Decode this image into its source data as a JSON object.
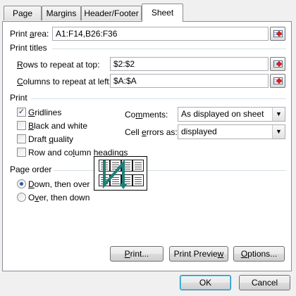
{
  "tabs": [
    "Page",
    "Margins",
    "Header/Footer",
    "Sheet"
  ],
  "active_tab": "Sheet",
  "print_area": {
    "label_pre": "Print ",
    "label_key": "a",
    "label_post": "rea:",
    "value": "A1:F14,B26:F36"
  },
  "print_titles": {
    "heading": "Print titles",
    "rows": {
      "label_key": "R",
      "label_post": "ows to repeat at top:",
      "value": "$2:$2"
    },
    "cols": {
      "label_key": "C",
      "label_post": "olumns to repeat at left:",
      "value": "$A:$A"
    }
  },
  "print": {
    "heading": "Print",
    "gridlines": {
      "label_key": "G",
      "label_post": "ridlines",
      "checked": true
    },
    "black_white": {
      "label_key": "B",
      "label_post": "lack and white",
      "checked": false
    },
    "draft": {
      "label_pre": "Draft ",
      "label_key": "q",
      "label_post": "uality",
      "checked": false
    },
    "row_col_headings": {
      "label_pre": "Row and co",
      "label_key": "l",
      "label_post": "umn headings",
      "checked": false
    },
    "comments": {
      "label_pre": "Co",
      "label_key": "m",
      "label_post": "ments:",
      "value": "As displayed on sheet"
    },
    "cell_errors": {
      "label_pre": "Cell ",
      "label_key": "e",
      "label_post": "rrors as:",
      "value": "displayed"
    }
  },
  "page_order": {
    "heading": "Page order",
    "down_then_over": {
      "label_key": "D",
      "label_post": "own, then over",
      "selected": true
    },
    "over_then_down": {
      "label_pre": "O",
      "label_key": "v",
      "label_post": "er, then down",
      "selected": false
    }
  },
  "buttons": {
    "print": {
      "label_key": "P",
      "label_post": "rint..."
    },
    "preview": {
      "label_pre": "Print Previe",
      "label_key": "w",
      "label_post": ""
    },
    "options": {
      "label_key": "O",
      "label_post": "ptions..."
    },
    "ok": "OK",
    "cancel": "Cancel"
  },
  "colors": {
    "panel_bg": "#ffffff",
    "dialog_bg": "#f0f0f0",
    "arrow": "#1f7f78",
    "accent": "#2a55a8"
  },
  "icons": [
    "collapse-dialog-icon",
    "checkmark-icon",
    "dropdown-arrow-icon",
    "page-order-illustration"
  ]
}
